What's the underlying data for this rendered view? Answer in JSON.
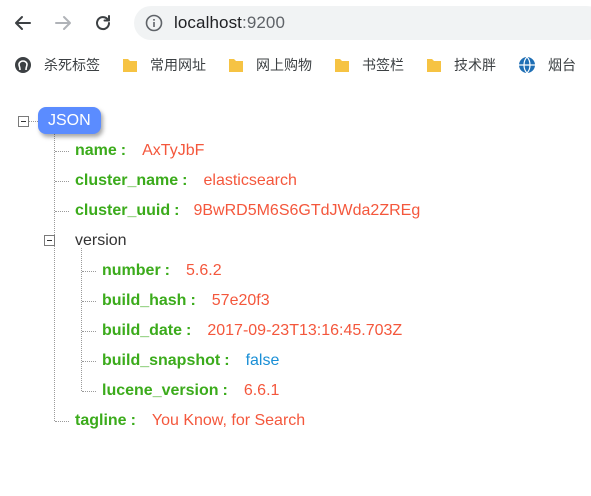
{
  "browser": {
    "url_host": "localhost",
    "url_port": ":9200"
  },
  "bookmarks": [
    {
      "label": "杀死标签",
      "icon": "github-icon"
    },
    {
      "label": "常用网址",
      "icon": "folder-icon"
    },
    {
      "label": "网上购物",
      "icon": "folder-icon"
    },
    {
      "label": "书签栏",
      "icon": "folder-icon"
    },
    {
      "label": "技术胖",
      "icon": "folder-icon"
    },
    {
      "label": "烟台",
      "icon": "globe-icon"
    }
  ],
  "json": {
    "root_label": "JSON",
    "fields": {
      "name": {
        "key": "name",
        "value": "AxTyJbF"
      },
      "cluster_name": {
        "key": "cluster_name",
        "value": "elasticsearch"
      },
      "cluster_uuid": {
        "key": "cluster_uuid",
        "value": "9BwRD5M6S6GTdJWda2ZREg"
      },
      "version": {
        "key": "version"
      },
      "tagline": {
        "key": "tagline",
        "value": "You Know, for Search"
      }
    },
    "version": {
      "number": {
        "key": "number",
        "value": "5.6.2"
      },
      "build_hash": {
        "key": "build_hash",
        "value": "57e20f3"
      },
      "build_date": {
        "key": "build_date",
        "value": "2017-09-23T13:16:45.703Z"
      },
      "build_snapshot": {
        "key": "build_snapshot",
        "value": "false"
      },
      "lucene_version": {
        "key": "lucene_version",
        "value": "6.6.1"
      }
    },
    "colors": {
      "key": "#3bab1b",
      "string": "#f4573c",
      "boolean": "#1a8fd6",
      "badge": "#5b8cff"
    }
  }
}
